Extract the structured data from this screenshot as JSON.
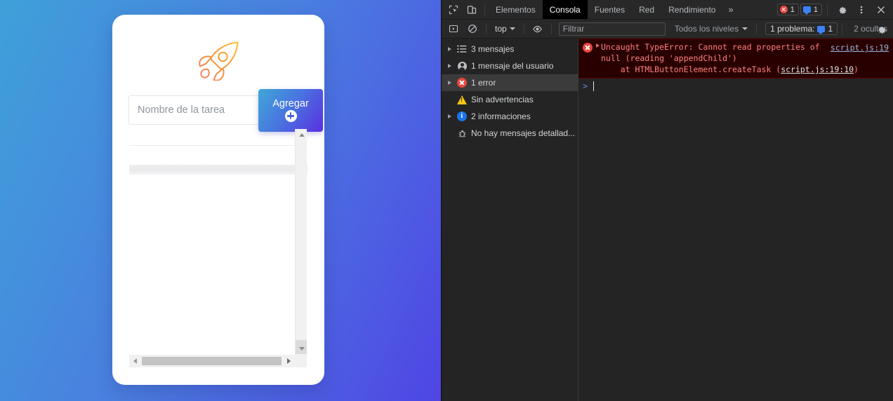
{
  "page": {
    "background_gradient_from": "#3fa0d9",
    "background_gradient_to": "#4f45e4",
    "card": {
      "logo_icon": "rocket-icon",
      "input_placeholder": "Nombre de la tarea",
      "input_value": "",
      "add_button_label": "Agregar",
      "add_button_icon": "plus-circle-icon",
      "task_list_items": []
    },
    "scrollbars": {
      "vertical_up_icon": "triangle-up-icon",
      "vertical_down_icon": "triangle-down-icon",
      "horizontal_left_icon": "triangle-left-icon",
      "horizontal_right_icon": "triangle-right-icon"
    }
  },
  "devtools": {
    "tabbar": {
      "inspect_icon": "inspect-cursor-icon",
      "device_icon": "device-toolbar-icon",
      "tabs": [
        {
          "label": "Elementos",
          "active": false
        },
        {
          "label": "Consola",
          "active": true
        },
        {
          "label": "Fuentes",
          "active": false
        },
        {
          "label": "Red",
          "active": false
        },
        {
          "label": "Rendimiento",
          "active": false
        }
      ],
      "more_tabs_label": "»",
      "error_badge_count": "1",
      "message_badge_count": "1",
      "settings_icon": "gear-icon",
      "more_options_icon": "kebab-menu-icon",
      "close_icon": "close-icon"
    },
    "toolbar": {
      "sidebar_toggle_icon": "console-sidebar-toggle-icon",
      "clear_console_icon": "clear-console-icon",
      "context_label": "top",
      "eye_icon": "live-expression-eye-icon",
      "filter_placeholder": "Filtrar",
      "filter_value": "",
      "levels_label": "Todos los niveles",
      "problems_label": "1 problema:",
      "problems_count": "1",
      "hidden_label": "2 ocultos",
      "settings_icon": "console-settings-gear-icon"
    },
    "sidebar": {
      "items": [
        {
          "label": "3 mensajes",
          "icon": "list-icon",
          "expandable": true,
          "selected": false
        },
        {
          "label": "1 mensaje del usuario",
          "icon": "user-icon",
          "expandable": true,
          "selected": false
        },
        {
          "label": "1 error",
          "icon": "error-icon",
          "expandable": true,
          "selected": true
        },
        {
          "label": "Sin advertencias",
          "icon": "warning-icon",
          "expandable": false,
          "selected": false
        },
        {
          "label": "2 informaciones",
          "icon": "info-icon",
          "expandable": true,
          "selected": false
        },
        {
          "label": "No hay mensajes detallad...",
          "icon": "verbose-bug-icon",
          "expandable": false,
          "selected": false
        }
      ]
    },
    "console": {
      "error": {
        "icon": "error-icon",
        "line1": "Uncaught TypeError: Cannot read properties of",
        "line2": "null (reading 'appendChild')",
        "stack_prefix": "    at HTMLButtonElement.createTask (",
        "stack_link": "script.js:19:10",
        "stack_suffix": ")",
        "source_link": "script.js:19"
      },
      "prompt_symbol": ">",
      "prompt_value": ""
    }
  }
}
